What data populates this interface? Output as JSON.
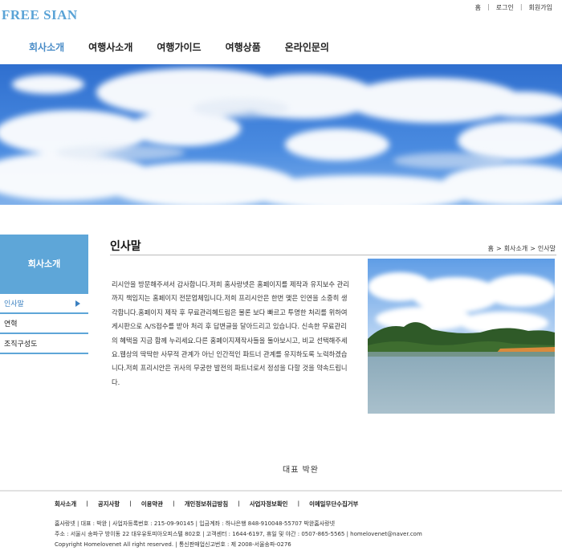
{
  "brand": {
    "logo": "FREE SIAN"
  },
  "utility": {
    "home": "홈",
    "login": "로그인",
    "join": "회원가입",
    "sep": "|"
  },
  "gnb": [
    {
      "label": "회사소개",
      "active": true
    },
    {
      "label": "여행사소개"
    },
    {
      "label": "여행가이드"
    },
    {
      "label": "여행상품"
    },
    {
      "label": "온라인문의"
    }
  ],
  "sidebar": {
    "title": "회사소개",
    "items": [
      {
        "label": "인사말",
        "active": true
      },
      {
        "label": "연혁"
      },
      {
        "label": "조직구성도"
      }
    ]
  },
  "content": {
    "title": "인사말",
    "breadcrumb": {
      "home": "홈",
      "sep": ">",
      "level1": "회사소개",
      "level2": "인사말"
    },
    "greeting": "리시안을 방문해주셔서 감사합니다.저희 홈사랑넷은 홈페이지를 제작과 유지보수 관리까지 책임지는 홈페이지 전문업체입니다.저희 프리시안은 한번 맺은 인연을 소중히 생각합니다.홈페이지 제작 후 무료관리혜드림은 물론 보다 빠르고 투명한 처리를 위하여 게시판으로 A/S접수를 받아 처리 후 답변글을 달아드리고 있습니다. 신속한 무료관리의 혜택을 지금 함께 누리세요.다른 홈페이지제작사들을 둘아보시고, 비교 선택해주세요.웹상의 딱딱한 사무적 관계가 아닌 인간적인 파트너 관계를 유지하도록 노력하겠습니다.저희 프리시안은 귀사의 무궁한 발전의 파트너로서 정성을 다할 것을 약속드립니다.",
    "signature": "대표 박완"
  },
  "footer": {
    "links": [
      "회사소개",
      "공지사항",
      "이용약관",
      "개인정보취급방침",
      "사업자정보확인",
      "이메일무단수집거부"
    ],
    "sep": "|",
    "line1": "홈사랑넷  |  대표 : 박완  |  사업자등록번호 : 215-09-90145  |  입금계좌 : 하나은행 848-910048-55707 박완홈사랑넷",
    "line2": "주소 : 서울시 송파구 방이동 22 대우유토피아오피스텔 802호  |  고객센터 : 1644-6197, 휴일 및 야간 : 0507-865-5565  |  homelovenet@naver.com",
    "line3": "Copyright Homelovenet All right reserved.  |  통신판매업신고번호 : 제 2008-서울송파-0276"
  },
  "colors": {
    "accent": "#5ea6d8",
    "active": "#3b80c0",
    "sky": "#3f7fd6"
  },
  "icons": {
    "side_arrow": "triangle-right-icon",
    "breadcrumb_home": "home-icon"
  }
}
